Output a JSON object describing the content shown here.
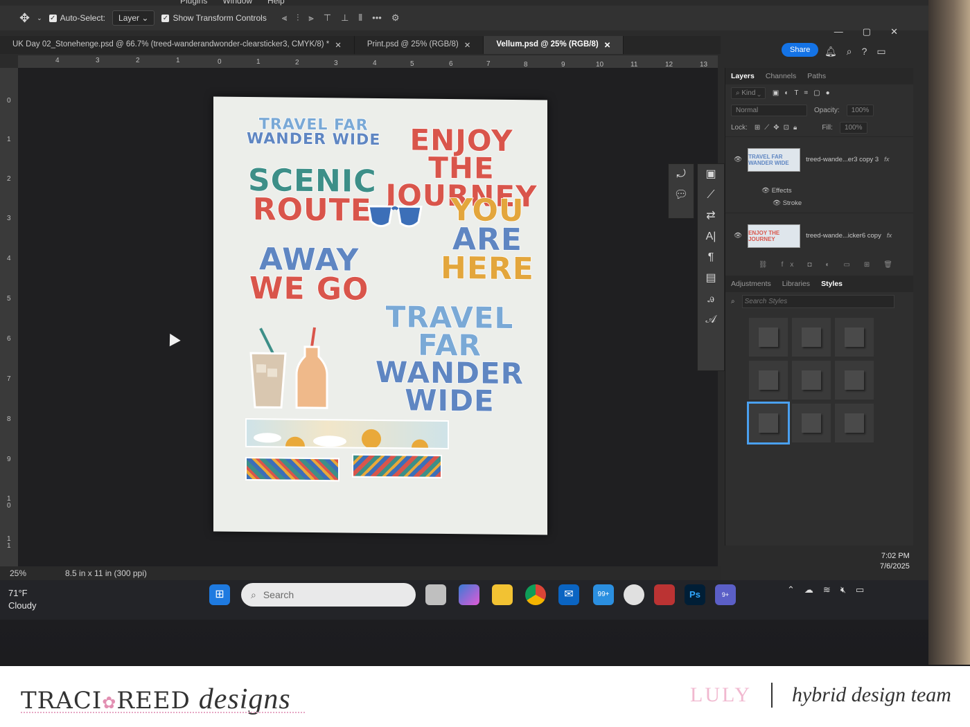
{
  "menu": [
    "Plugins",
    "Window",
    "Help"
  ],
  "options_bar": {
    "auto_select_label": "Auto-Select:",
    "auto_select_value": "Layer",
    "show_transform_label": "Show Transform Controls"
  },
  "window_controls": [
    "—",
    "▢",
    "✕"
  ],
  "tabs": [
    {
      "label": "UK Day 02_Stonehenge.psd @ 66.7% (treed-wanderandwonder-clearsticker3, CMYK/8) *",
      "close": "✕"
    },
    {
      "label": "Print.psd @ 25% (RGB/8)",
      "close": "✕"
    },
    {
      "label": "Vellum.psd @ 25% (RGB/8)",
      "close": "✕"
    }
  ],
  "share_label": "Share",
  "ruler_h": [
    "4",
    "3",
    "2",
    "1",
    "0",
    "1",
    "2",
    "3",
    "4",
    "5",
    "6",
    "7",
    "8",
    "9",
    "10",
    "11",
    "12",
    "13"
  ],
  "ruler_v": [
    "0",
    "1",
    "2",
    "3",
    "4",
    "5",
    "6",
    "7",
    "8",
    "9",
    "1 0",
    "1 1"
  ],
  "stickers": {
    "s1": [
      "TRAVEL FAR",
      "WANDER WIDE"
    ],
    "s2": [
      "ENJOY THE",
      "JOURNEY"
    ],
    "s3": [
      "SCENIC",
      "ROUTE"
    ],
    "s4": [
      "YOU",
      "ARE",
      "HERE"
    ],
    "s5": [
      "AWAY",
      "WE GO"
    ],
    "s6": [
      "TRAVEL FAR",
      "WANDER WIDE"
    ]
  },
  "panel": {
    "tabs": [
      "Layers",
      "Channels",
      "Paths"
    ],
    "kind_label": "Kind",
    "blend_mode": "Normal",
    "opacity_label": "Opacity:",
    "opacity_value": "100%",
    "lock_label": "Lock:",
    "fill_label": "Fill:",
    "fill_value": "100%",
    "layers": [
      {
        "name": "treed-wande...er3 copy 3",
        "thumb": "TRAVEL FAR WANDER WIDE"
      },
      {
        "name": "treed-wande...icker6 copy",
        "thumb": "ENJOY THE JOURNEY"
      }
    ],
    "fx_label": "fx",
    "effects_label": "Effects",
    "stroke_label": "Stroke",
    "lower_tabs": [
      "Adjustments",
      "Libraries",
      "Styles"
    ],
    "search_styles_placeholder": "Search Styles"
  },
  "status": {
    "zoom": "25%",
    "doc_size": "8.5 in x 11 in (300 ppi)"
  },
  "taskbar": {
    "temp": "71°F",
    "condition": "Cloudy",
    "search_placeholder": "Search",
    "badge_mail": "99+",
    "badge_teams": "9+",
    "time": "7:02 PM",
    "date": "7/6/2025"
  },
  "footer": {
    "brand_left_1": "TRACI",
    "brand_left_2": "REED",
    "brand_left_script": "designs",
    "brand_right_name": "LULY",
    "brand_right_team": "hybrid design team"
  }
}
